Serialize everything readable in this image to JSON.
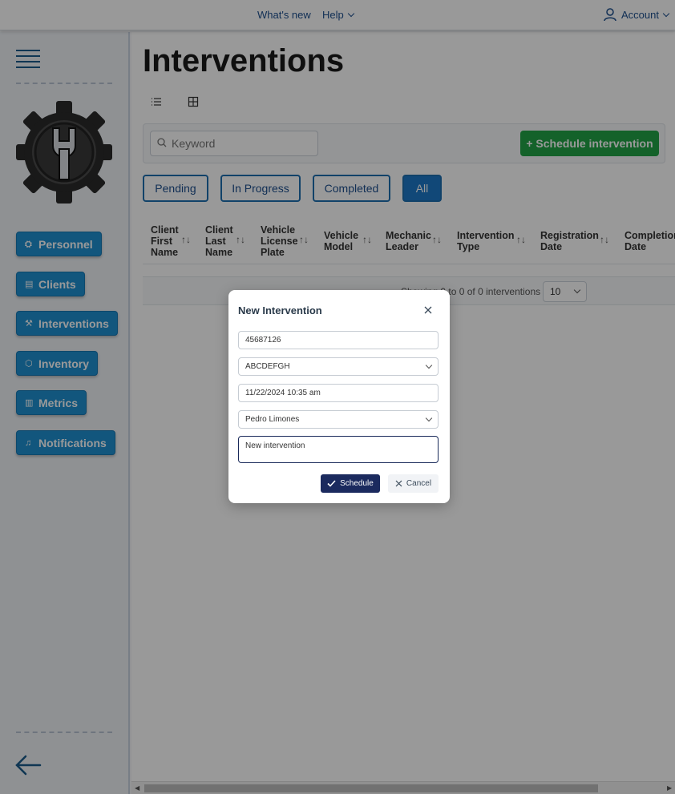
{
  "topbar": {
    "whats_new": "What's new",
    "help": "Help",
    "account": "Account"
  },
  "sidebar": {
    "items": [
      {
        "label": "Personnel",
        "icon": "personnel-icon"
      },
      {
        "label": "Clients",
        "icon": "clients-card-icon"
      },
      {
        "label": "Interventions",
        "icon": "wrench-icon"
      },
      {
        "label": "Inventory",
        "icon": "box-icon"
      },
      {
        "label": "Metrics",
        "icon": "bar-chart-icon"
      },
      {
        "label": "Notifications",
        "icon": "bell-icon"
      }
    ]
  },
  "main": {
    "title": "Interventions",
    "search_placeholder": "Keyword",
    "schedule_button": "+ Schedule intervention",
    "filters": [
      "Pending",
      "In Progress",
      "Completed",
      "All"
    ],
    "active_filter": "All",
    "columns": [
      "Client\nFirst\nName",
      "Client\nLast\nName",
      "Vehicle\nLicense\nPlate",
      "Vehicle\nModel",
      "Mechanic\nLeader",
      "Intervention\nType",
      "Registration\nDate",
      "Completion\nDate"
    ],
    "paginator_text": "Showing 0 to 0 of 0 interventions",
    "rows_per_page": "10"
  },
  "dialog": {
    "title": "New Intervention",
    "field_client_id": "45687126",
    "field_plate": "ABCDEFGH",
    "field_date": "11/22/2024 10:35 am",
    "field_mechanic": "Pedro Limones",
    "field_description": "New intervention",
    "schedule_label": "Schedule",
    "cancel_label": "Cancel"
  },
  "colors": {
    "primary": "#1e8fd0",
    "success": "#22a447",
    "dialog_primary": "#1b2a5e"
  }
}
